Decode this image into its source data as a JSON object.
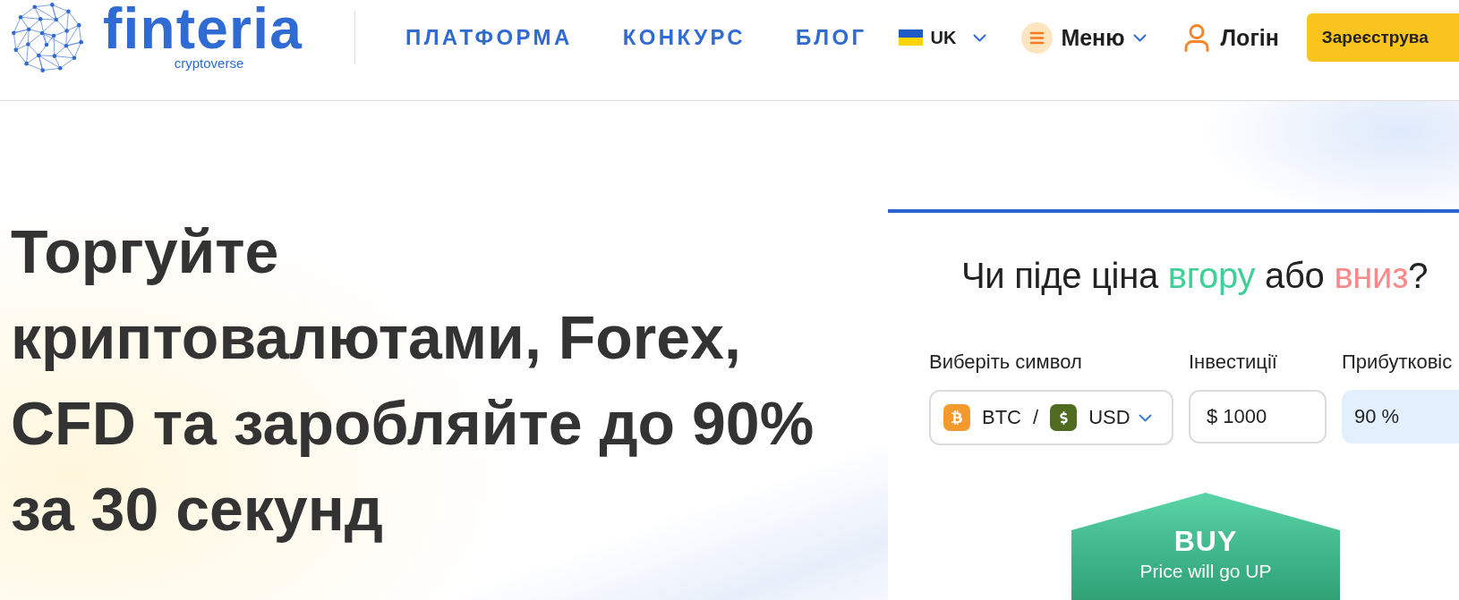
{
  "header": {
    "logo": {
      "wordmark": "finteria",
      "tagline": "cryptoverse"
    },
    "nav": [
      {
        "label": "ПЛАТФОРМА"
      },
      {
        "label": "КОНКУРС"
      },
      {
        "label": "БЛОГ"
      }
    ],
    "language": {
      "code": "UK"
    },
    "menu": {
      "label": "Меню"
    },
    "login": {
      "label": "Логін"
    },
    "register": {
      "label": "Зареєструва"
    }
  },
  "hero": {
    "headline": "Торгуйте криптовалютами, Forex, CFD та заробляйте до 90% за 30 секунд"
  },
  "trade_widget": {
    "question": [
      {
        "text": "Чи піде ціна ",
        "kind": "plain"
      },
      {
        "text": "вгору",
        "kind": "up"
      },
      {
        "text": " або ",
        "kind": "plain"
      },
      {
        "text": "вниз",
        "kind": "down"
      },
      {
        "text": "?",
        "kind": "plain"
      }
    ],
    "symbol": {
      "label": "Виберіть символ",
      "base": "BTC",
      "separator": "/",
      "quote": "USD"
    },
    "investment": {
      "label": "Інвестиції",
      "value": "$ 1000"
    },
    "profit": {
      "label": "Прибутковіс",
      "value": "90 %"
    },
    "buy": {
      "title": "BUY",
      "subtitle": "Price will go UP"
    }
  }
}
